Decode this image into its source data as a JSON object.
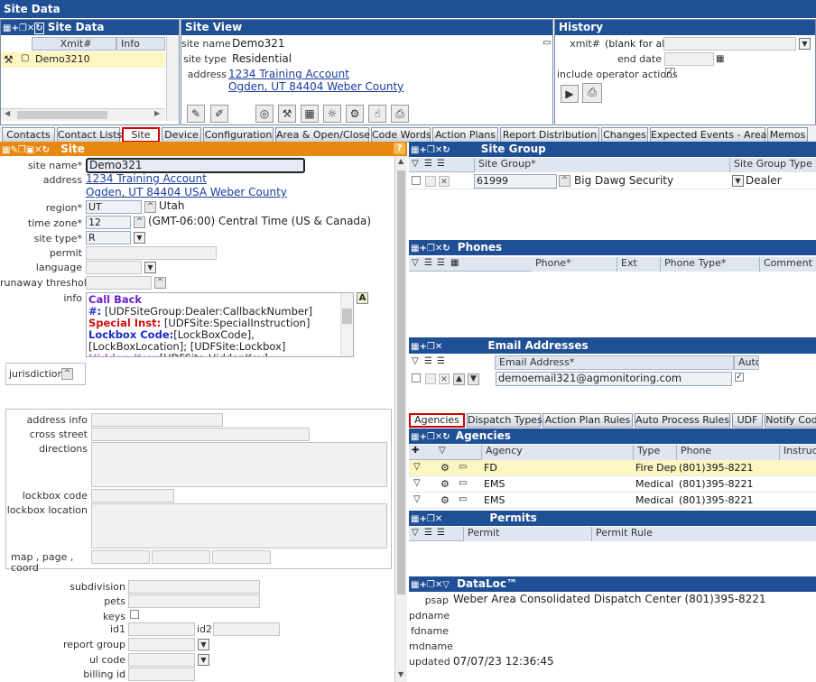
{
  "window": {
    "title": "Site Data"
  },
  "site_data": {
    "title": "Site Data",
    "col_xmit": "Xmit#",
    "col_info": "Info",
    "row": "Demo3210"
  },
  "site_view": {
    "title": "Site View",
    "site_name_label": "site name",
    "site_name": "Demo321",
    "site_type_label": "site type",
    "site_type": "Residential",
    "address_label": "address",
    "address1": "1234 Training Account",
    "address2": "Ogden, UT 84404   Weber County"
  },
  "history": {
    "title": "History",
    "xmit_label": "xmit#",
    "xmit_hint": "(blank for all)",
    "end_date_label": "end date",
    "include_label": "include operator actions"
  },
  "tabs": [
    "Contacts",
    "Contact Lists",
    "Site",
    "Device",
    "Configuration",
    "Area & Open/Close",
    "Code Words",
    "Action Plans",
    "Report Distribution",
    "Changes",
    "Expected Events - Areas",
    "Memos"
  ],
  "site": {
    "title": "Site",
    "site_name_label": "site name*",
    "site_name": "Demo321",
    "address_label": "address",
    "address1": "1234 Training Account",
    "address2": "Ogden, UT 84404 USA   Weber County",
    "region_label": "region*",
    "region": "UT",
    "region_name": "Utah",
    "tz_label": "time zone*",
    "tz": "12",
    "tz_name": "(GMT-06:00) Central Time (US & Canada)",
    "type_label": "site type*",
    "type": "R",
    "permit_label": "permit",
    "language_label": "language",
    "runaway_label": "runaway threshold",
    "info_label": "info",
    "info_lines": [
      {
        "a": "Call Back",
        "b": ""
      },
      {
        "a": "#:",
        "b": " [UDFSiteGroup:Dealer:CallbackNumber]"
      },
      {
        "a": "Special Inst:",
        "b": " [UDFSite:SpecialInstruction]"
      },
      {
        "a": "Lockbox Code:",
        "b": "[LockBoxCode],"
      },
      {
        "a": "",
        "b": "[LockBoxLocation]; [UDFSite:Lockbox]"
      },
      {
        "a": "Hidden Key:",
        "b": "[UDFSite:HiddenKey]"
      }
    ],
    "jurisdiction_label": "jurisdiction",
    "address_info_label": "address info",
    "cross_street_label": "cross street",
    "directions_label": "directions",
    "lockbox_code_label": "lockbox code",
    "lockbox_location_label": "lockbox location",
    "map_label": "map ,  page ,",
    "coord_label": "coord",
    "subdivision_label": "subdivision",
    "pets_label": "pets",
    "keys_label": "keys",
    "id1_label": "id1",
    "id2_label": "id2",
    "report_group_label": "report group",
    "ul_code_label": "ul code",
    "billing_label": "billing id"
  },
  "site_group": {
    "title": "Site Group",
    "col1": "Site Group*",
    "col2": "Site Group Type",
    "code": "61999",
    "name": "Big Dawg Security",
    "type": "Dealer"
  },
  "phones": {
    "title": "Phones",
    "cols": [
      "Phone*",
      "Ext",
      "Phone Type*",
      "Comment"
    ]
  },
  "email": {
    "title": "Email Addresses",
    "col1": "Email Address*",
    "col2": "Auto",
    "value": "demoemail321@agmonitoring.com"
  },
  "subtabs": [
    "Agencies",
    "Dispatch Types",
    "Action Plan Rules",
    "Auto Process Rules",
    "UDF",
    "Notify Cod"
  ],
  "agencies": {
    "title": "Agencies",
    "cols": [
      "Agency",
      "Type",
      "Phone",
      "Instruct"
    ],
    "rows": [
      {
        "agency": "FD",
        "type": "Fire Dep",
        "phone": "(801)395-8221"
      },
      {
        "agency": "EMS",
        "type": "Medical",
        "phone": "(801)395-8221"
      },
      {
        "agency": "EMS",
        "type": "Medical",
        "phone": "(801)395-8221"
      }
    ]
  },
  "permits": {
    "title": "Permits",
    "col1": "Permit",
    "col2": "Permit Rule"
  },
  "dataloc": {
    "title": "DataLoc™",
    "psap_label": "psap",
    "psap": "Weber Area Consolidated Dispatch Center  (801)395-8221",
    "pdname_label": "pdname",
    "fdname_label": "fdname",
    "mdname_label": "mdname",
    "updated_label": "updated",
    "updated": "07/07/23 12:36:45"
  },
  "colors": {
    "accent": "#1f4f94",
    "site_header": "#e88712",
    "highlight": "#fdf6c3"
  }
}
